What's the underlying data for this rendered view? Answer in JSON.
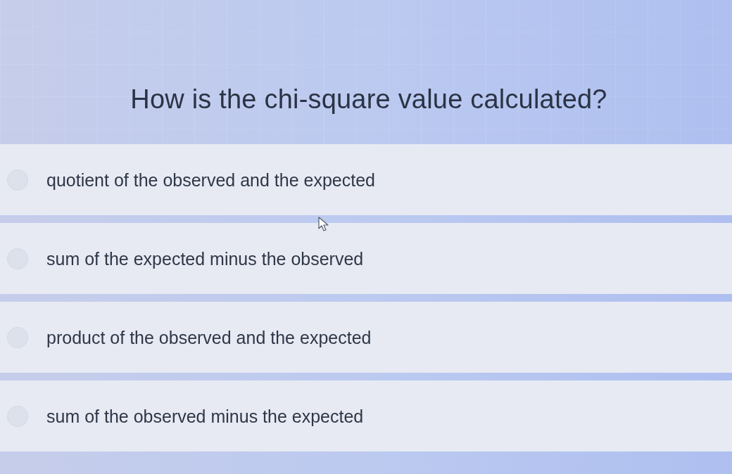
{
  "question": "How is the chi-square value calculated?",
  "options": [
    {
      "label": "quotient of the observed and the expected",
      "selected": false
    },
    {
      "label": "sum of the expected minus the observed",
      "selected": false
    },
    {
      "label": "product of the observed and the expected",
      "selected": false
    },
    {
      "label": "sum of the observed minus the expected",
      "selected": false
    }
  ]
}
